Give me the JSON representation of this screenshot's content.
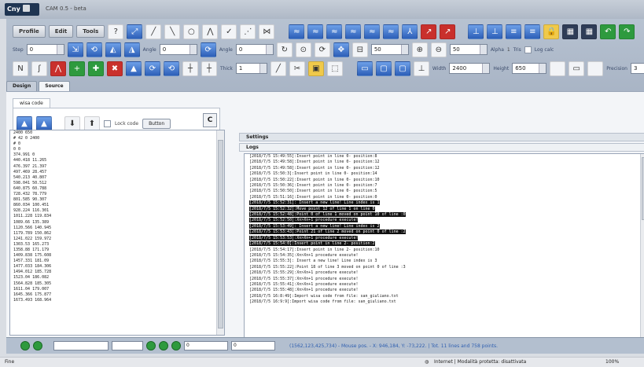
{
  "window": {
    "title": "CAM 0.5 - beta",
    "logo": "Cny"
  },
  "toolbar1": {
    "profile": "Profile",
    "edit": "Edit",
    "tools": "Tools",
    "help": "?",
    "help_text": "?"
  },
  "toolbar2": {
    "step_label": "Step",
    "step_value": "0",
    "angle_label": "Angle",
    "angle_value": "0",
    "angle2_label": "Angle",
    "angle2_value": "0",
    "snap1": "50",
    "snap2": "50",
    "alpha_label": "Alpha",
    "alpha_value": "1",
    "tris_label": "Tris",
    "log_label": "Log calc"
  },
  "toolbar3": {
    "thick_label": "Thick",
    "thick_value": "1",
    "width_label": "Width",
    "width_value": "2400",
    "height_label": "Height",
    "height_value": "650",
    "precision_label": "Precision",
    "precision_value": "3"
  },
  "tabs": [
    "Design",
    "Source"
  ],
  "source": {
    "subtab": "wisa code",
    "lock_label": "Lock code",
    "button_label": "Button",
    "c_label": "C"
  },
  "code_lines": [
    "2400 650",
    "# 42 0 2400",
    "# 0",
    "0 0",
    "374.991 0",
    "440.418 11.265",
    "476.397 21.397",
    "497.469 28.457",
    "540.213 40.807",
    "598.041 50.512",
    "640.875 60.788",
    "728.432 78.779",
    "801.585 90.307",
    "860.034 100.451",
    "928.224 116.301",
    "1011.228 119.834",
    "1089.66 135.389",
    "1120.566 140.945",
    "1179.789 150.862",
    "1241.022 159.972",
    "1303.53 165.273",
    "1358.88 171.179",
    "1409.838 175.608",
    "1457.331 181.09",
    "1477.033 184.306",
    "1494.012 185.728",
    "1523.04 186.082",
    "1564.828 185.305",
    "1611.04 179.007",
    "1645.366 175.877",
    "1673.493 168.964"
  ],
  "settings": {
    "header": "Settings",
    "logs_header": "Logs"
  },
  "log_lines": [
    "[2018/7/5 15:49:55]:Insert point in line 0- position:8",
    "[2018/7/5 15:49:58]:Insert point in line 0- position:12",
    "[2018/7/5 15:49:58]:Insert point in line 0- position:12",
    "[2018/7/5 15:50:3]:Insert point in line 0- position:14",
    "[2018/7/5 15:50:22]:Insert point in line 0- position:10",
    "[2018/7/5 15:50:36]:Insert point in line 0- position:7",
    "[2018/7/5 15:50:50]:Insert point in line 0- position:5",
    "[2018/7/5 15:51:16]:Insert point in line 0- position:0",
    "[2018/7/5 15:52:31]: Insert a new line! Line index is 1",
    "[2018/7/5 15:52:32]:Move point 12 of line 1 on line 0",
    "[2018/7/5 15:52:48]:Point 0 of line 1 moved on point 10 of line :0",
    "[2018/7/5 15:52:50]:Xn>Xn+1 procedure execute!",
    "[2018/7/5 15:53:49]: Insert a new line! Line index is 2",
    "[2018/7/5 15:53:43]:Point 21 of line 2 moved on point 0 of line :2",
    "[2018/7/5 15:53:53]:Xn>Xn+1 procedure execute!",
    "[2018/7/5 15:54:0]:Insert point in line 2- position:2",
    "[2018/7/5 15:54:17]:Insert point in line 2- position:10",
    "[2018/7/5 15:54:35]:Xn>Xn+1 procedure execute!",
    "[2018/7/5 15:55:3]: Insert a new line! Line index is 3",
    "[2018/7/5 15:55:22]:Point 18 of line 3 moved on point 0 of line :3",
    "[2018/7/5 15:55:29]:Xn>Xn+1 procedure execute!",
    "[2018/7/5 15:55:37]:Xn>Xn+1 procedure execute!",
    "[2018/7/5 15:55:41]:Xn>Xn+1 procedure execute!",
    "[2018/7/5 15:55:48]:Xn>Xn+1 procedure execute!",
    "[2018/7/5 16:8:49]:Import wisa code from file: san_giuliano.txt",
    "[2018/7/5 16:9:9]:Import wisa code from file: san_giuliano.txt"
  ],
  "highlight_from": 8,
  "highlight_to": 15,
  "bottom": {
    "field1": "0",
    "field2": "0",
    "status": "(1562,123,425,734) - Mouse pos. - X: 946,184, Y: -73,222. | Tot. 11 lines and 758 points."
  },
  "statusbar": {
    "left": "Fine",
    "zone": "Internet | Modalità protetta: disattivata",
    "zoom": "100%"
  }
}
